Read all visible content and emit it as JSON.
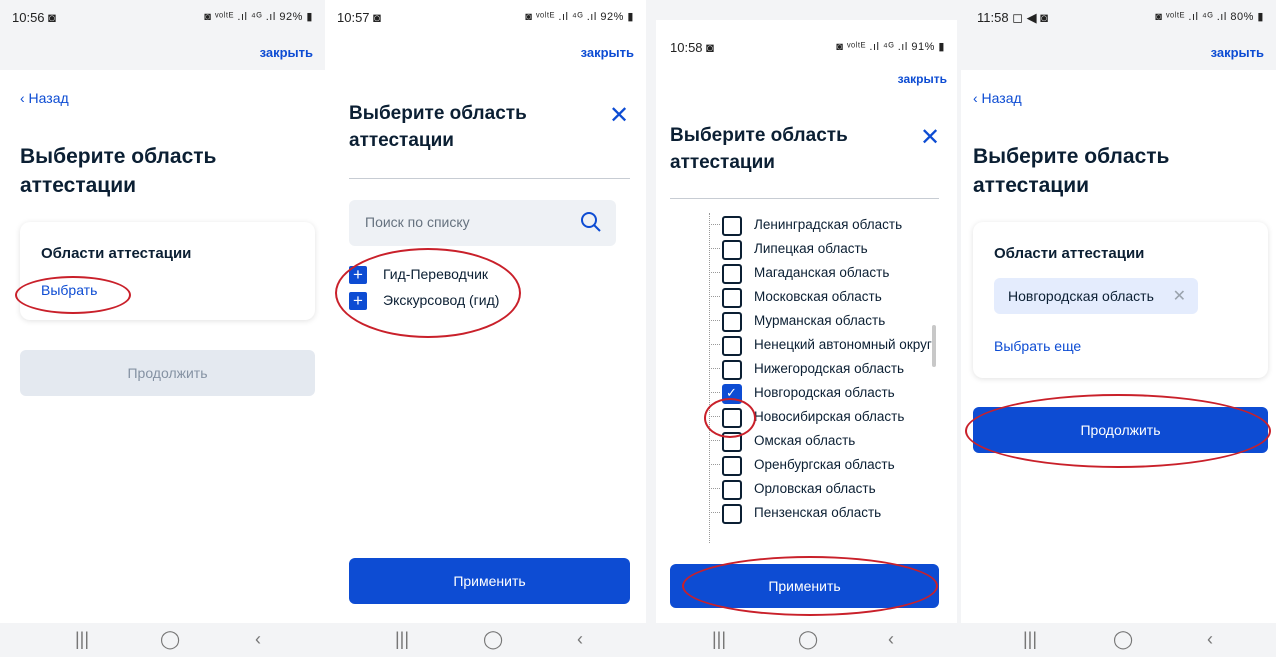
{
  "screens": [
    {
      "status": {
        "time": "10:56 ◙",
        "icons": "◙ ᵛᵒˡᵗᴱ .ıl ⁴ᴳ .ıl 92% ▮"
      },
      "close_label": "закрыть",
      "back_label": "‹ Назад",
      "title": "Выберите область аттестации",
      "card_title": "Области аттестации",
      "select_link": "Выбрать",
      "continue_label": "Продолжить"
    },
    {
      "status": {
        "time": "10:57 ◙",
        "icons": "◙ ᵛᵒˡᵗᴱ .ıl ⁴ᴳ .ıl 92% ▮"
      },
      "close_label": "закрыть",
      "modal_title": "Выберите область аттестации",
      "search_placeholder": "Поиск по списку",
      "tree_items": [
        "Гид-Переводчик",
        "Экскурсовод (гид)"
      ],
      "apply_label": "Применить"
    },
    {
      "status": {
        "time": "10:58 ◙",
        "icons": "◙ ᵛᵒˡᵗᴱ .ıl ⁴ᴳ .ıl 91% ▮"
      },
      "close_label": "закрыть",
      "modal_title": "Выберите область аттестации",
      "regions": [
        {
          "label": "Ленинградская область",
          "checked": false
        },
        {
          "label": "Липецкая область",
          "checked": false
        },
        {
          "label": "Магаданская область",
          "checked": false
        },
        {
          "label": "Московская область",
          "checked": false
        },
        {
          "label": "Мурманская область",
          "checked": false
        },
        {
          "label": "Ненецкий автономный округ",
          "checked": false
        },
        {
          "label": "Нижегородская область",
          "checked": false
        },
        {
          "label": "Новгородская область",
          "checked": true
        },
        {
          "label": "Новосибирская область",
          "checked": false
        },
        {
          "label": "Омская область",
          "checked": false
        },
        {
          "label": "Оренбургская область",
          "checked": false
        },
        {
          "label": "Орловская область",
          "checked": false
        },
        {
          "label": "Пензенская область",
          "checked": false
        }
      ],
      "apply_label": "Применить"
    },
    {
      "status": {
        "time": "11:58 ◻ ◀ ◙",
        "icons": "◙ ᵛᵒˡᵗᴱ .ıl ⁴ᴳ .ıl 80% ▮"
      },
      "close_label": "закрыть",
      "back_label": "‹ Назад",
      "title": "Выберите область аттестации",
      "card_title": "Области аттестации",
      "chip_label": "Новгородская область",
      "select_more_link": "Выбрать еще",
      "continue_label": "Продолжить"
    }
  ],
  "navbar": {
    "recents": "|||",
    "home": "◯",
    "back": "‹"
  },
  "accent_color": "#0d4cd3",
  "annotation_color": "#c9202a"
}
